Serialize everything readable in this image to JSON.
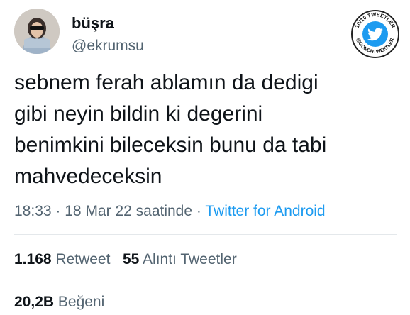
{
  "user": {
    "display_name": "büşra",
    "handle": "@ekrumsu"
  },
  "badge": {
    "top_text": "10/10 TWEETLER",
    "bottom_text": "@GONCHTWEETLER",
    "icon": "twitter-bird-icon",
    "color": "#1d9bf0"
  },
  "tweet": {
    "lines": [
      "sebnem ferah ablamın da dedigi",
      "gibi neyin bildin ki degerini",
      "benimkini bileceksin bunu da tabi",
      "mahvedeceksin"
    ]
  },
  "meta": {
    "time": "18:33",
    "sep1": "·",
    "date": "18 Mar 22 saatinde",
    "sep2": "·",
    "source": "Twitter for Android"
  },
  "stats": {
    "retweet_count": "1.168",
    "retweet_label": "Retweet",
    "quote_count": "55",
    "quote_label": "Alıntı Tweetler",
    "like_count": "20,2B",
    "like_label": "Beğeni"
  },
  "colors": {
    "text": "#0f1419",
    "secondary": "#536471",
    "accent": "#1d9bf0"
  }
}
